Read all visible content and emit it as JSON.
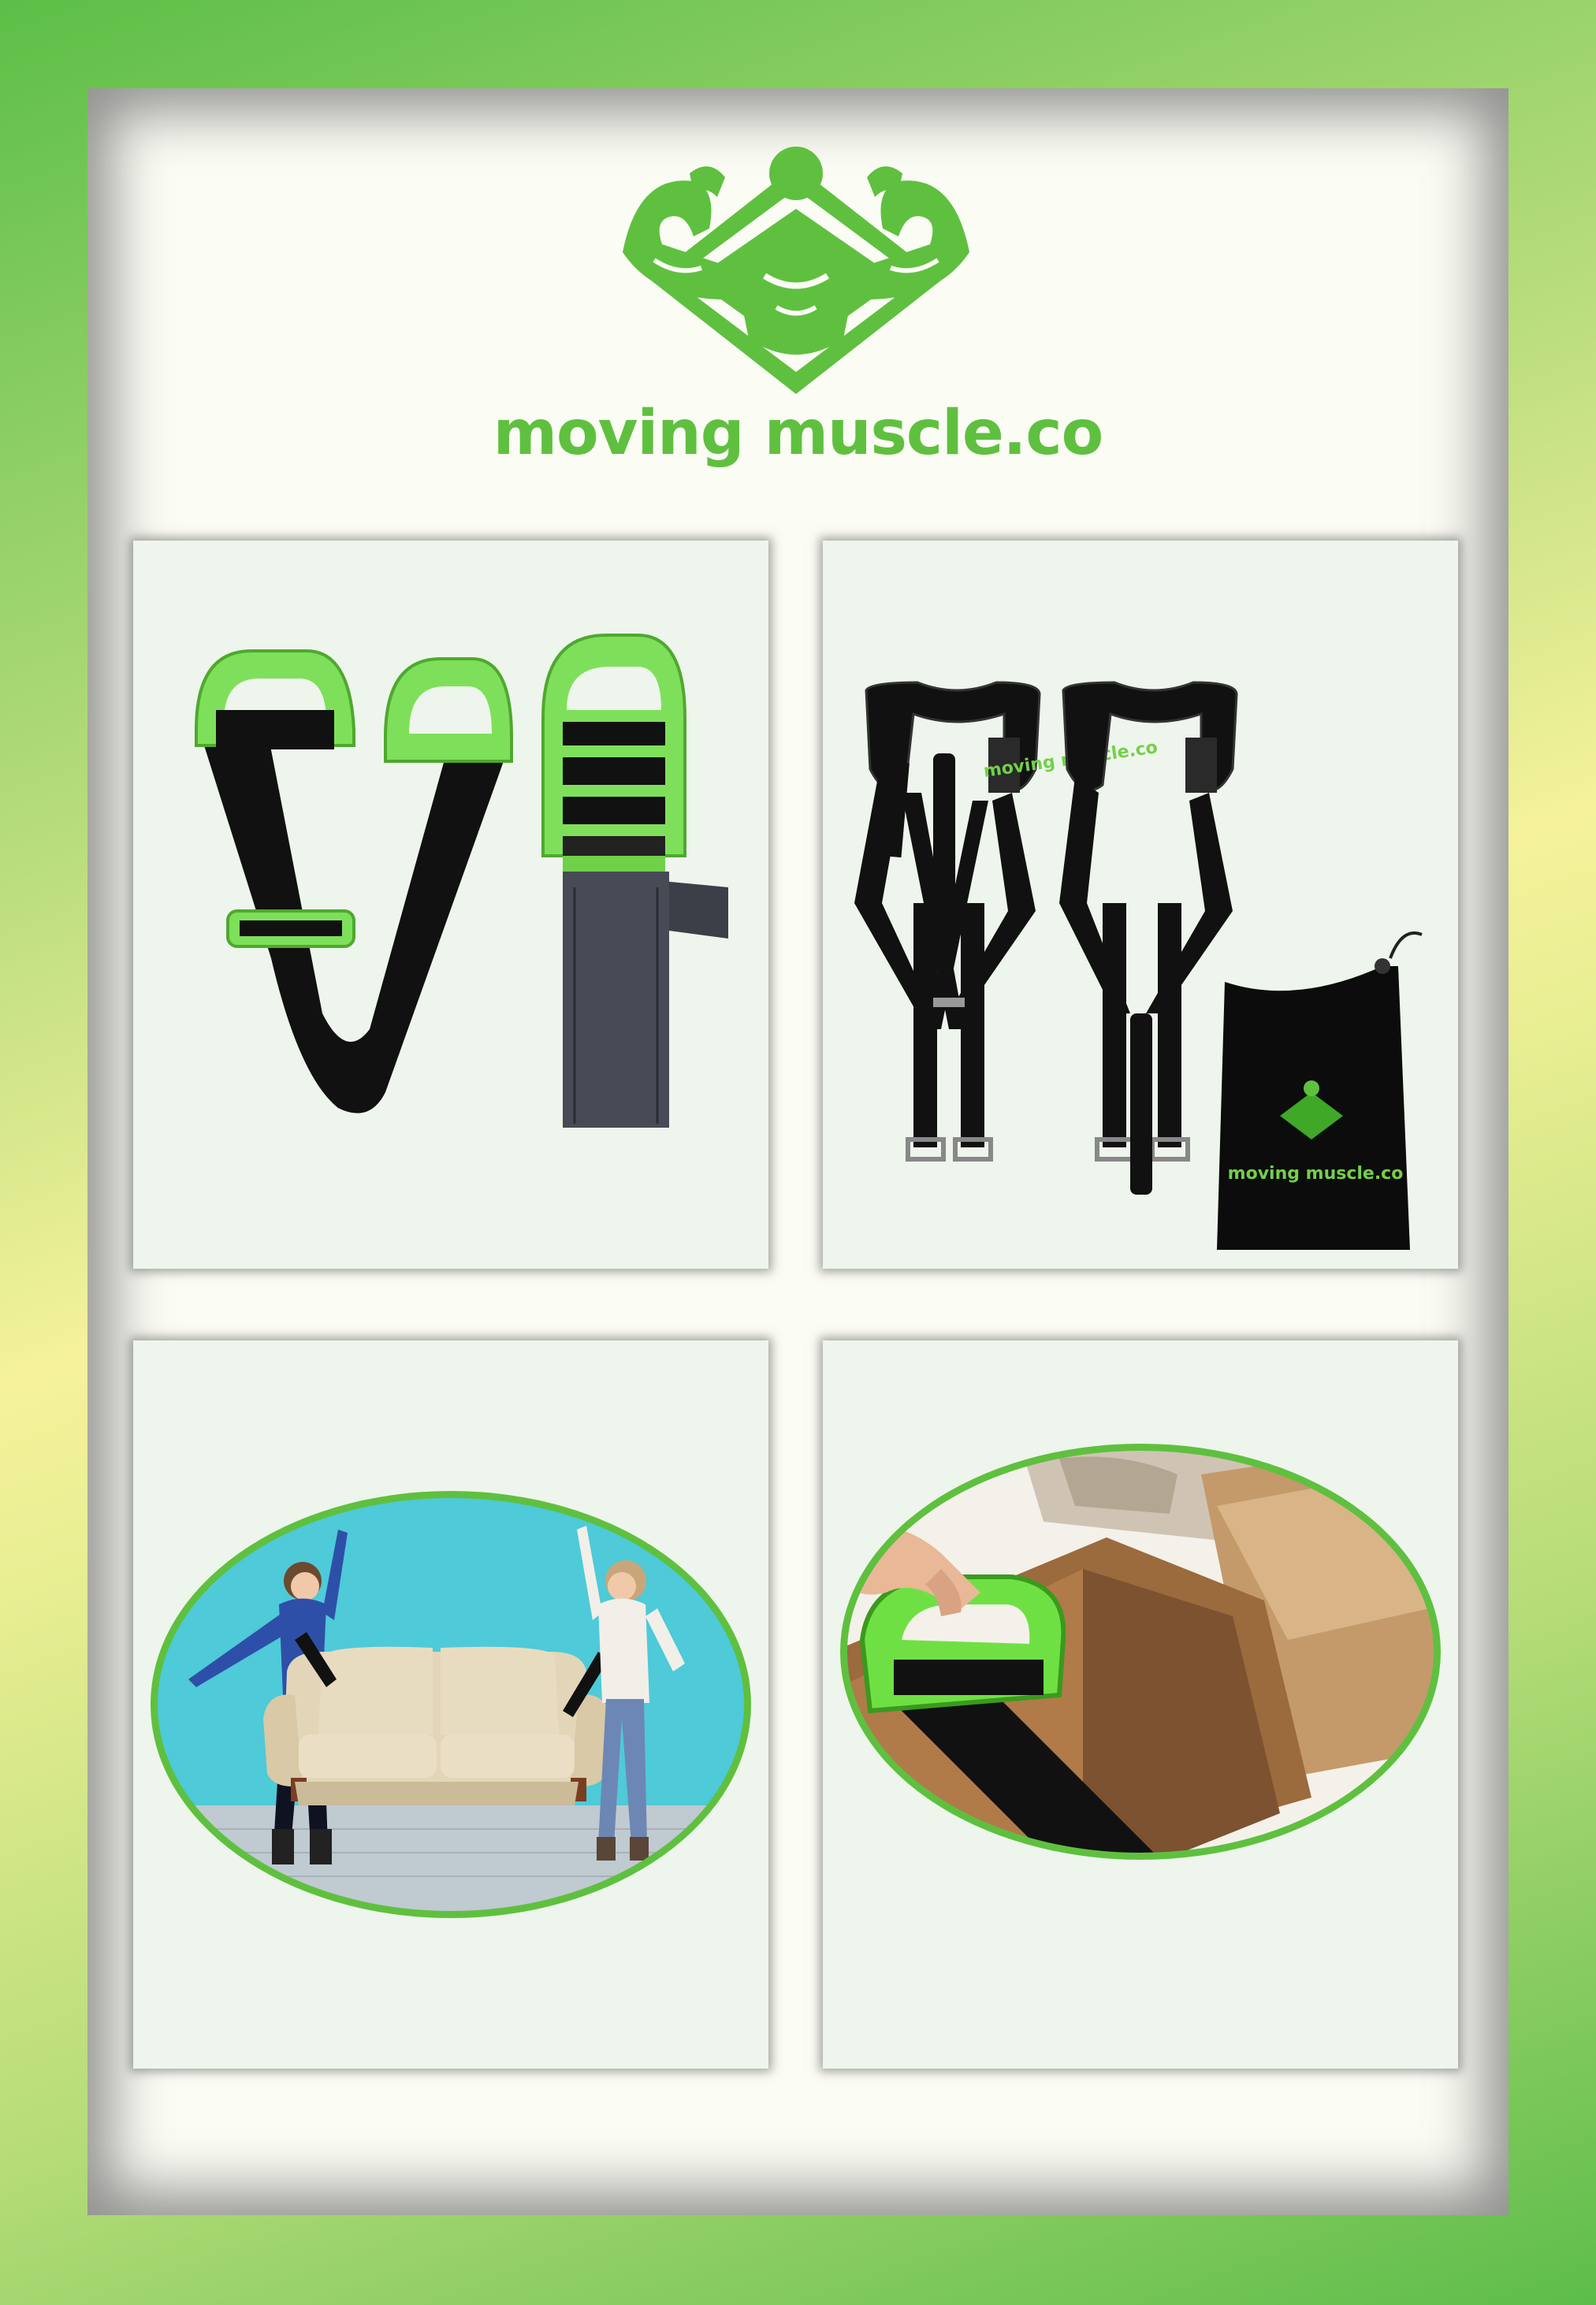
{
  "brand": {
    "name": "moving muscle.co",
    "logo_icon": "muscle-man-diamond-icon",
    "accent_color": "#5fc03f"
  },
  "products": [
    {
      "label": "",
      "icon": "lifting-straps-with-handles"
    },
    {
      "label": "",
      "icon": "shoulder-harness-set-with-bag",
      "bag_text": "moving muscle.co",
      "harness_text": "moving muscle.co"
    },
    {
      "label": "",
      "icon": "two-women-lifting-couch"
    },
    {
      "label": "",
      "icon": "hand-lifting-box-with-strap"
    }
  ]
}
